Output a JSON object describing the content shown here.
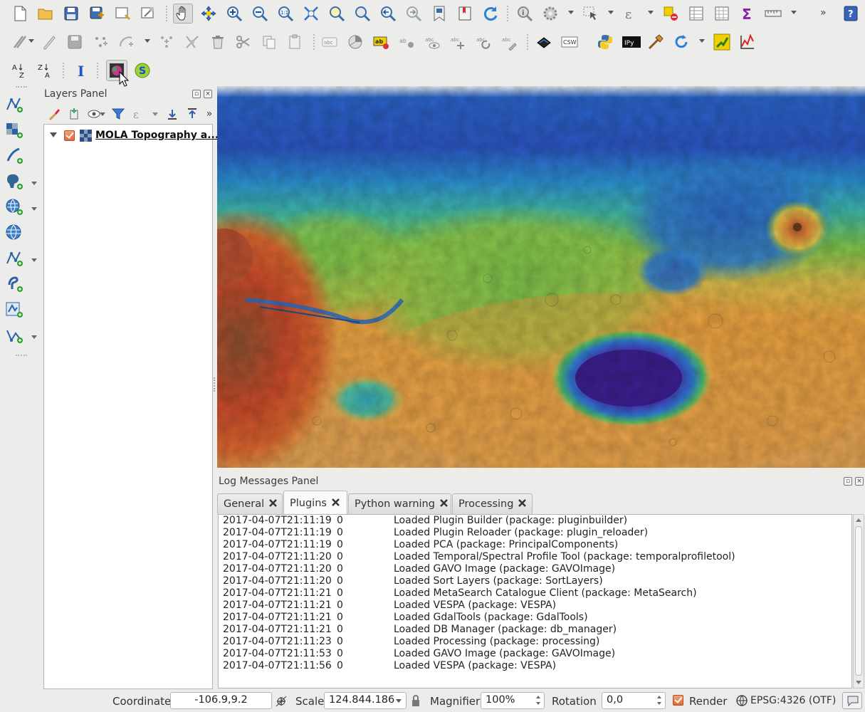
{
  "toolbar1": {
    "icons": [
      "new-project-icon",
      "open-project-icon",
      "save-project-icon",
      "save-as-icon",
      "new-print-layout-icon",
      "layout-manager-icon",
      "pan-map-icon",
      "pan-to-selection-icon",
      "zoom-in-icon",
      "zoom-out-icon",
      "zoom-native-icon",
      "zoom-full-icon",
      "zoom-to-selection-icon",
      "zoom-to-layer-icon",
      "zoom-last-icon",
      "zoom-next-icon",
      "new-bookmark-icon",
      "show-bookmarks-icon",
      "refresh-icon",
      "identify-icon",
      "measure-settings-icon",
      "select-features-icon",
      "expression-select-icon",
      "deselect-icon",
      "attribute-table-icon",
      "field-calculator-icon",
      "statistics-icon",
      "measure-line-icon",
      "more-tools-icon",
      "help-icon"
    ]
  },
  "toolbar2": {
    "icons": [
      "current-edits-icon",
      "toggle-editing-icon",
      "save-edits-icon",
      "add-feature-icon",
      "add-circular-string-icon",
      "move-feature-icon",
      "node-tool-icon",
      "delete-selected-icon",
      "cut-features-icon",
      "copy-features-icon",
      "paste-features-icon",
      "label-icon",
      "diagram-icon",
      "highlight-labels-icon",
      "pin-labels-icon",
      "show-hide-labels-icon",
      "move-label-icon",
      "rotate-label-icon",
      "change-label-icon",
      "metasearch-icon",
      "csw-icon",
      "python-console-icon",
      "ipython-icon",
      "plugin-builder-icon",
      "plugin-reloader-icon",
      "processing-toolbox-icon",
      "profile-tool-icon"
    ],
    "csw_label": "CSW",
    "ipy_label": "IPy"
  },
  "toolbar3": {
    "sort_az_label": "A Z",
    "sort_za_label": "Z A",
    "icons": [
      "sort-layers-az-icon",
      "sort-layers-za-icon",
      "identify-text-icon",
      "gavo-image-icon",
      "vespa-icon"
    ]
  },
  "left_toolbar": {
    "icons": [
      "add-vector-layer-icon",
      "add-raster-layer-icon",
      "add-delimited-text-icon",
      "add-postgis-icon",
      "add-wms-icon",
      "add-wcs-icon",
      "add-wfs-icon",
      "add-spatialite-icon",
      "add-virtual-layer-icon",
      "new-shapefile-icon"
    ]
  },
  "layers_panel": {
    "title": "Layers Panel",
    "layers": [
      {
        "name": "MOLA Topography a...",
        "checked": true
      }
    ]
  },
  "log_panel": {
    "title": "Log Messages Panel",
    "tabs": [
      {
        "label": "General",
        "active": false
      },
      {
        "label": "Plugins",
        "active": true
      },
      {
        "label": "Python warning",
        "active": false
      },
      {
        "label": "Processing",
        "active": false
      }
    ],
    "rows": [
      {
        "ts": "2017-04-07T21:11:19",
        "level": "0",
        "msg": "Loaded Plugin Builder (package: pluginbuilder)"
      },
      {
        "ts": "2017-04-07T21:11:19",
        "level": "0",
        "msg": "Loaded Plugin Reloader (package: plugin_reloader)"
      },
      {
        "ts": "2017-04-07T21:11:19",
        "level": "0",
        "msg": "Loaded PCA (package: PrincipalComponents)"
      },
      {
        "ts": "2017-04-07T21:11:20",
        "level": "0",
        "msg": "Loaded Temporal/Spectral Profile Tool (package: temporalprofiletool)"
      },
      {
        "ts": "2017-04-07T21:11:20",
        "level": "0",
        "msg": "Loaded GAVO Image (package: GAVOImage)"
      },
      {
        "ts": "2017-04-07T21:11:20",
        "level": "0",
        "msg": "Loaded Sort Layers (package: SortLayers)"
      },
      {
        "ts": "2017-04-07T21:11:21",
        "level": "0",
        "msg": "Loaded MetaSearch Catalogue Client (package: MetaSearch)"
      },
      {
        "ts": "2017-04-07T21:11:21",
        "level": "0",
        "msg": "Loaded VESPA (package: VESPA)"
      },
      {
        "ts": "2017-04-07T21:11:21",
        "level": "0",
        "msg": "Loaded GdalTools (package: GdalTools)"
      },
      {
        "ts": "2017-04-07T21:11:21",
        "level": "0",
        "msg": "Loaded DB Manager (package: db_manager)"
      },
      {
        "ts": "2017-04-07T21:11:23",
        "level": "0",
        "msg": "Loaded Processing (package: processing)"
      },
      {
        "ts": "2017-04-07T21:11:53",
        "level": "0",
        "msg": "Loaded GAVO Image (package: GAVOImage)"
      },
      {
        "ts": "2017-04-07T21:11:56",
        "level": "0",
        "msg": "Loaded VESPA (package: VESPA)"
      }
    ]
  },
  "statusbar": {
    "coordinate_label": "Coordinate",
    "coordinate_value": "-106.9,9.2",
    "scale_label": "Scale",
    "scale_value": "124.844.186",
    "magnifier_label": "Magnifier",
    "magnifier_value": "100%",
    "rotation_label": "Rotation",
    "rotation_value": "0,0",
    "render_label": "Render",
    "render_checked": true,
    "crs_label": "EPSG:4326 (OTF)"
  },
  "colors": {
    "accent_orange": "#e46a33",
    "window_bg": "#ececeb",
    "map_low": "#3a1e8c",
    "map_mid": "#4caf50",
    "map_high": "#d25a2a"
  }
}
